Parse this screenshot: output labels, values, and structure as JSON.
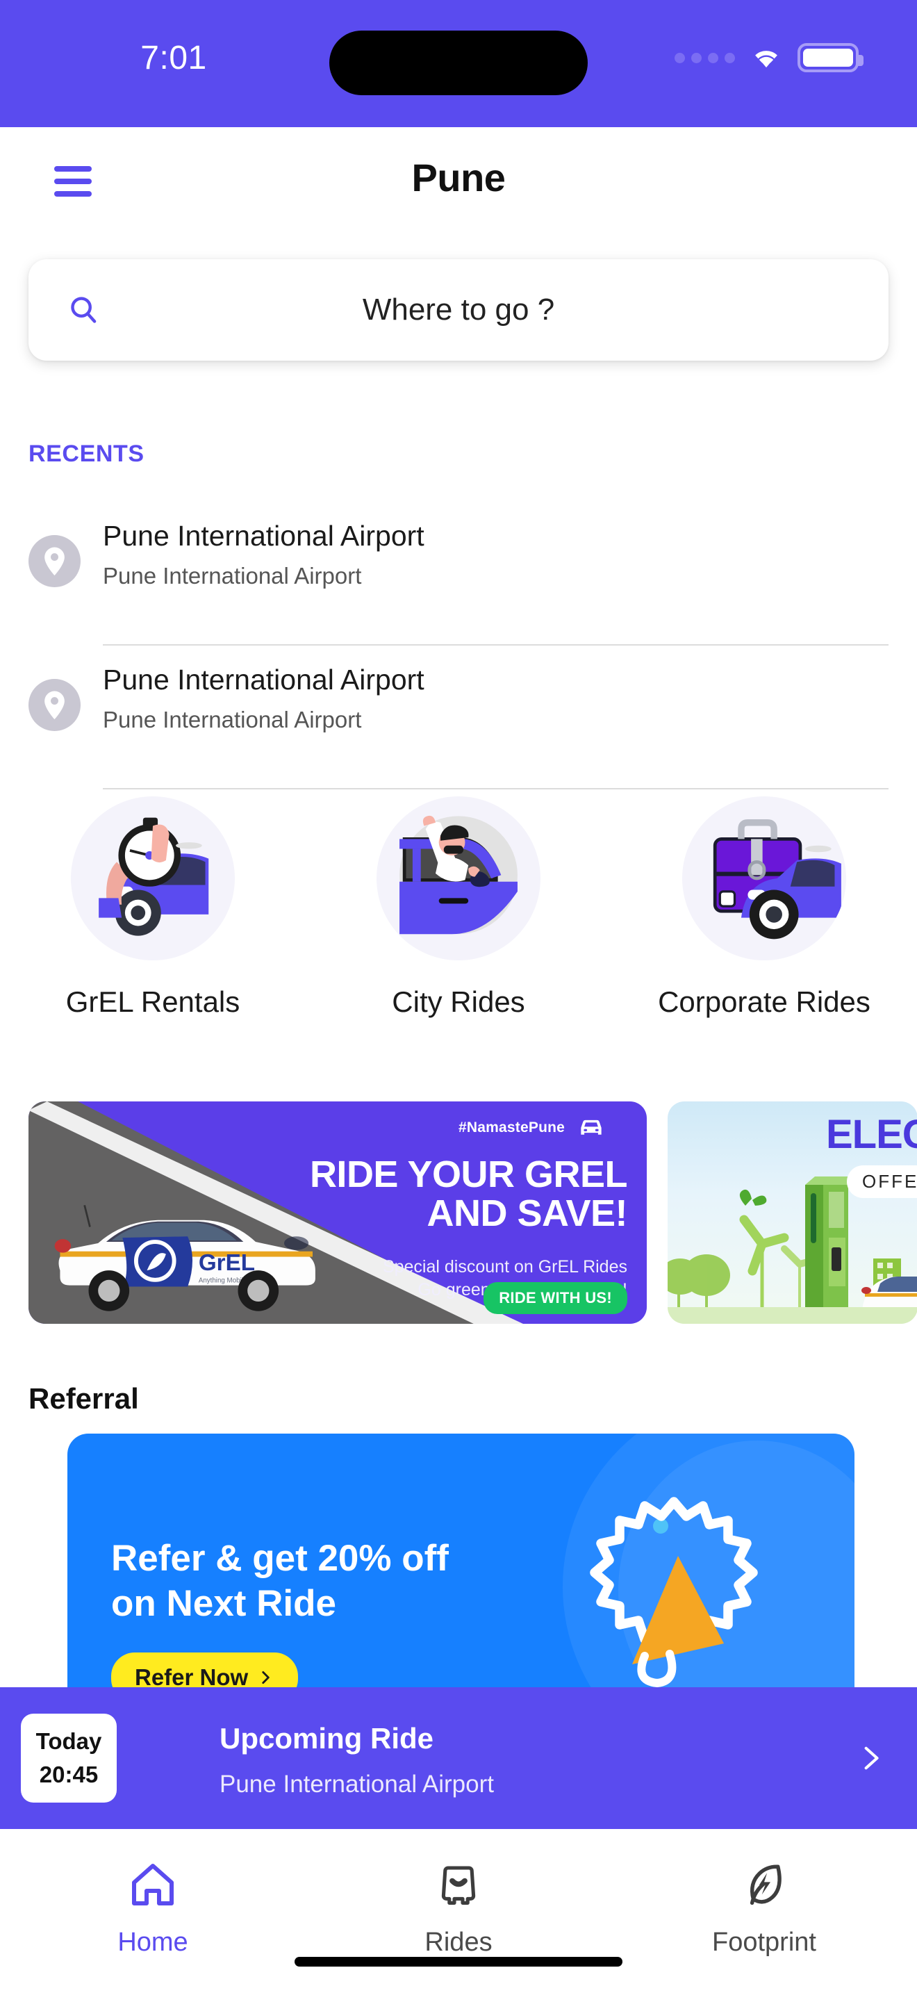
{
  "status_bar": {
    "time": "7:01",
    "signal_icon": "signal-dots-icon",
    "wifi_icon": "wifi-icon",
    "battery_icon": "battery-full-icon"
  },
  "header": {
    "menu_icon": "hamburger-menu-icon",
    "title": "Pune"
  },
  "search": {
    "icon": "search-icon",
    "placeholder": "Where to go ?",
    "value": ""
  },
  "recents": {
    "label": "RECENTS",
    "items": [
      {
        "icon": "location-pin-icon",
        "title": "Pune International Airport",
        "subtitle": "Pune International Airport"
      },
      {
        "icon": "location-pin-icon",
        "title": "Pune International Airport",
        "subtitle": "Pune International Airport"
      }
    ]
  },
  "categories": [
    {
      "label": "GrEL Rentals",
      "icon": "stopwatch-car-icon"
    },
    {
      "label": "City Rides",
      "icon": "waving-passenger-car-icon"
    },
    {
      "label": "Corporate Rides",
      "icon": "briefcase-car-icon"
    }
  ],
  "banners": [
    {
      "hashtag": "#NamastePune",
      "car_icon": "car-front-icon",
      "headline_line1": "RIDE YOUR GREL",
      "headline_line2": "AND SAVE!",
      "sub_line1": "Special discount on GrEL Rides",
      "sub_line2": "Go green and save money!",
      "cta": "RIDE WITH US!",
      "car_brand": "GrEL"
    },
    {
      "title": "ELEC",
      "offer_label": "OFFER"
    }
  ],
  "referral": {
    "section_label": "Referral",
    "headline_line1": "Refer & get 20% off",
    "headline_line2": "on Next Ride",
    "cta": "Refer Now",
    "cta_chevron": "chevron-right-icon",
    "illustration": "megaphone-icon"
  },
  "upcoming_ride": {
    "day": "Today",
    "time": "20:45",
    "title": "Upcoming Ride",
    "destination": "Pune International Airport",
    "chevron": "chevron-right-icon"
  },
  "bottom_nav": {
    "items": [
      {
        "label": "Home",
        "icon": "home-icon",
        "active": true
      },
      {
        "label": "Rides",
        "icon": "car-front-icon",
        "active": false
      },
      {
        "label": "Footprint",
        "icon": "leaf-bolt-icon",
        "active": false
      }
    ]
  },
  "colors": {
    "brand_purple": "#5a4bef",
    "banner_purple": "#5b3ee8",
    "referral_blue": "#1680ff",
    "cta_yellow": "#ffeb1f",
    "cta_green": "#17c464",
    "text_dark": "#111111"
  }
}
